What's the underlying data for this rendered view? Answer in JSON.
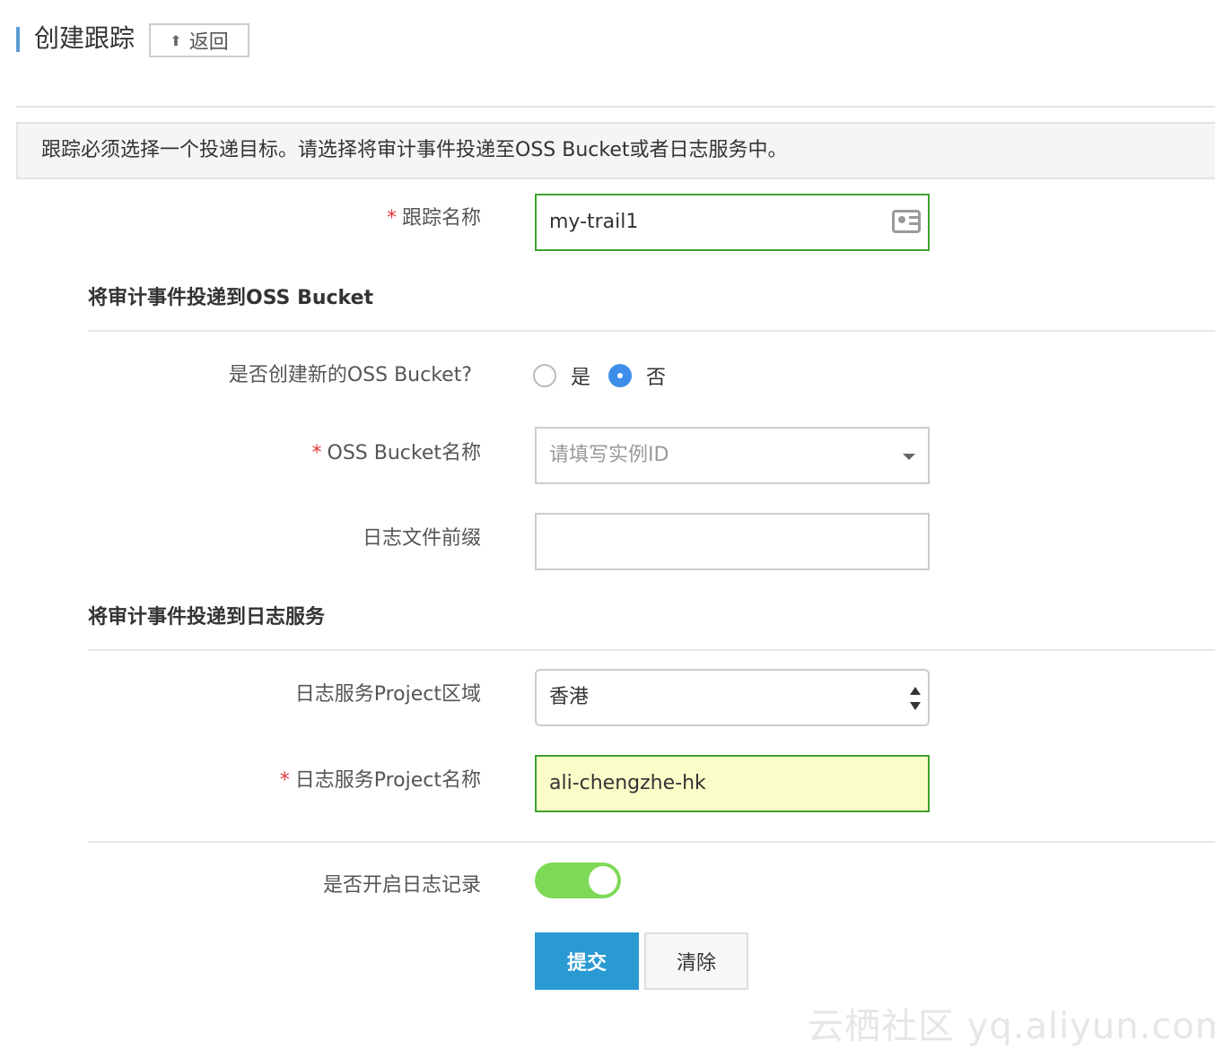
{
  "header": {
    "title": "创建跟踪",
    "back_label": "返回"
  },
  "notice": "跟踪必须选择一个投递目标。请选择将审计事件投递至OSS Bucket或者日志服务中。",
  "trail_name": {
    "label": "跟踪名称",
    "value": "my-trail1"
  },
  "oss_section": {
    "title": "将审计事件投递到OSS Bucket",
    "create_new": {
      "label": "是否创建新的OSS Bucket?",
      "options": [
        "是",
        "否"
      ],
      "selected": "否"
    },
    "bucket_name": {
      "label": "OSS Bucket名称",
      "placeholder": "请填写实例ID"
    },
    "log_prefix": {
      "label": "日志文件前缀",
      "value": ""
    }
  },
  "log_section": {
    "title": "将审计事件投递到日志服务",
    "project_region": {
      "label": "日志服务Project区域",
      "value": "香港"
    },
    "project_name": {
      "label": "日志服务Project名称",
      "value": "ali-chengzhe-hk"
    },
    "enable_logging": {
      "label": "是否开启日志记录",
      "enabled": true
    }
  },
  "actions": {
    "submit": "提交",
    "clear": "清除"
  },
  "watermark": "云栖社区 yq.aliyun.com",
  "colors": {
    "accent": "#2a9ad3",
    "valid_border": "#3ea12e",
    "toggle_on": "#7ed957",
    "required": "#e4393c"
  }
}
